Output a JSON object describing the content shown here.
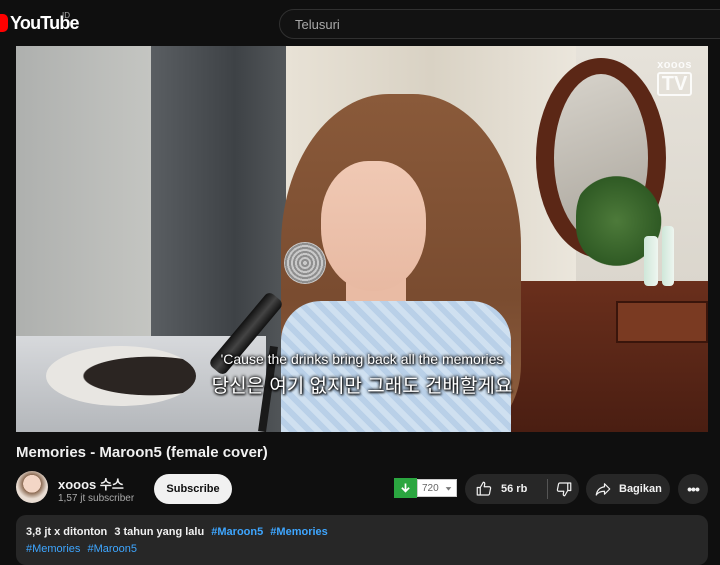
{
  "header": {
    "logo_text": "YouTube",
    "country_code": "ID",
    "search_placeholder": "Telusuri"
  },
  "video": {
    "watermark_top": "xooos",
    "watermark_bottom": "TV",
    "subtitle_en": "'Cause the drinks bring back all the memories",
    "subtitle_ko": "당신은 여기 없지만 그래도 건배할게요"
  },
  "title": "Memories - Maroon5 (female cover)",
  "channel": {
    "name": "xooos 수스",
    "subscribers": "1,57 jt subscriber",
    "subscribe_label": "Subscribe"
  },
  "download_ext": {
    "quality": "720"
  },
  "actions": {
    "like_count": "56 rb",
    "share_label": "Bagikan",
    "more_label": "•••"
  },
  "description": {
    "views": "3,8 jt x ditonton",
    "age": "3 tahun yang lalu",
    "hashtags_line1": [
      "#Maroon5",
      "#Memories"
    ],
    "hashtags_line2": [
      "#Memories",
      "#Maroon5"
    ]
  },
  "colors": {
    "background": "#0f0f0f",
    "brand_red": "#ff0000",
    "pill": "#272727",
    "link": "#3ea6ff",
    "download_green": "#2ba640"
  },
  "icons": [
    "youtube-logo-icon",
    "download-arrow-icon",
    "dropdown-caret-icon",
    "thumbs-up-icon",
    "thumbs-down-icon",
    "share-icon",
    "more-icon"
  ]
}
